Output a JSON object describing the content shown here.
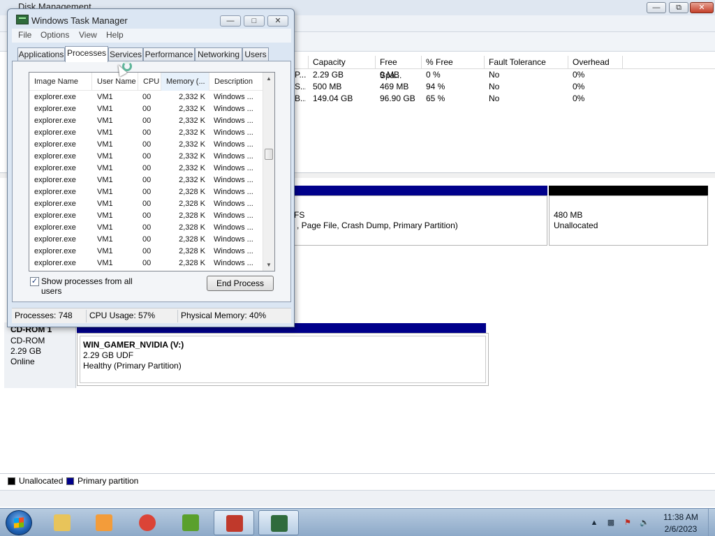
{
  "disk_management": {
    "title": "Disk Management",
    "volume_table": {
      "headers": [
        "Capacity",
        "Free Spa...",
        "% Free",
        "Fault Tolerance",
        "Overhead"
      ],
      "rows": [
        {
          "prefix": "P...",
          "capacity": "2.29 GB",
          "free": "0 MB",
          "pct": "0 %",
          "fault": "No",
          "overhead": "0%"
        },
        {
          "prefix": "S...",
          "capacity": "500 MB",
          "free": "469 MB",
          "pct": "94 %",
          "fault": "No",
          "overhead": "0%"
        },
        {
          "prefix": "B...",
          "capacity": "149.04 GB",
          "free": "96.90 GB",
          "pct": "65 %",
          "fault": "No",
          "overhead": "0%"
        }
      ]
    },
    "disk0": {
      "partition_line1": "FS",
      "partition_line2": ", Page File, Crash Dump, Primary Partition)",
      "unalloc_size": "480 MB",
      "unalloc_label": "Unallocated"
    },
    "cdrom": {
      "name": "CD-ROM 1",
      "type": "CD-ROM",
      "size": "2.29 GB",
      "status": "Online",
      "volume_name": "WIN_GAMER_NVIDIA  (V:)",
      "volume_size": "2.29 GB UDF",
      "volume_status": "Healthy (Primary Partition)"
    },
    "legend": {
      "unallocated": "Unallocated",
      "primary": "Primary partition",
      "unallocated_color": "#000000",
      "primary_color": "#00008b"
    }
  },
  "task_manager": {
    "title": "Windows Task Manager",
    "menu": [
      "File",
      "Options",
      "View",
      "Help"
    ],
    "tabs": [
      "Applications",
      "Processes",
      "Services",
      "Performance",
      "Networking",
      "Users"
    ],
    "active_tab": "Processes",
    "columns": [
      "Image Name",
      "User Name",
      "CPU",
      "Memory (...",
      "Description"
    ],
    "processes": [
      {
        "name": "explorer.exe",
        "user": "VM1",
        "cpu": "00",
        "mem": "2,332 K",
        "desc": "Windows ..."
      },
      {
        "name": "explorer.exe",
        "user": "VM1",
        "cpu": "00",
        "mem": "2,332 K",
        "desc": "Windows ..."
      },
      {
        "name": "explorer.exe",
        "user": "VM1",
        "cpu": "00",
        "mem": "2,332 K",
        "desc": "Windows ..."
      },
      {
        "name": "explorer.exe",
        "user": "VM1",
        "cpu": "00",
        "mem": "2,332 K",
        "desc": "Windows ..."
      },
      {
        "name": "explorer.exe",
        "user": "VM1",
        "cpu": "00",
        "mem": "2,332 K",
        "desc": "Windows ..."
      },
      {
        "name": "explorer.exe",
        "user": "VM1",
        "cpu": "00",
        "mem": "2,332 K",
        "desc": "Windows ..."
      },
      {
        "name": "explorer.exe",
        "user": "VM1",
        "cpu": "00",
        "mem": "2,332 K",
        "desc": "Windows ..."
      },
      {
        "name": "explorer.exe",
        "user": "VM1",
        "cpu": "00",
        "mem": "2,332 K",
        "desc": "Windows ..."
      },
      {
        "name": "explorer.exe",
        "user": "VM1",
        "cpu": "00",
        "mem": "2,328 K",
        "desc": "Windows ..."
      },
      {
        "name": "explorer.exe",
        "user": "VM1",
        "cpu": "00",
        "mem": "2,328 K",
        "desc": "Windows ..."
      },
      {
        "name": "explorer.exe",
        "user": "VM1",
        "cpu": "00",
        "mem": "2,328 K",
        "desc": "Windows ..."
      },
      {
        "name": "explorer.exe",
        "user": "VM1",
        "cpu": "00",
        "mem": "2,328 K",
        "desc": "Windows ..."
      },
      {
        "name": "explorer.exe",
        "user": "VM1",
        "cpu": "00",
        "mem": "2,328 K",
        "desc": "Windows ..."
      },
      {
        "name": "explorer.exe",
        "user": "VM1",
        "cpu": "00",
        "mem": "2,328 K",
        "desc": "Windows ..."
      },
      {
        "name": "explorer.exe",
        "user": "VM1",
        "cpu": "00",
        "mem": "2,328 K",
        "desc": "Windows ..."
      }
    ],
    "show_all_label": "Show processes from all users",
    "show_all_checked": true,
    "end_process_label": "End Process",
    "status": {
      "processes": "Processes: 748",
      "cpu": "CPU Usage: 57%",
      "memory": "Physical Memory: 40%"
    }
  },
  "taskbar": {
    "apps": [
      {
        "icon": "file-explorer-icon",
        "active": false,
        "color": "#e8c45a"
      },
      {
        "icon": "media-player-icon",
        "active": false,
        "color": "#f39c3a"
      },
      {
        "icon": "chrome-icon",
        "active": false,
        "color": "#db4437"
      },
      {
        "icon": "csharp-icon",
        "active": false,
        "color": "#5aa02c"
      },
      {
        "icon": "toolbox-icon",
        "active": true,
        "color": "#c0392b"
      },
      {
        "icon": "task-manager-icon",
        "active": true,
        "color": "#2f6b3c"
      }
    ],
    "time": "11:38 AM",
    "date": "2/6/2023"
  }
}
